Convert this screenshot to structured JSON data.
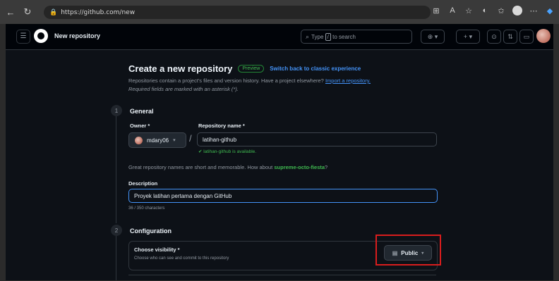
{
  "browser": {
    "url": "https://github.com/new",
    "icons": [
      "back-icon",
      "refresh-icon",
      "lock-icon",
      "grid-icon",
      "read-aloud-icon",
      "star-icon",
      "split-icon",
      "favorites-icon",
      "profile-icon",
      "more-icon",
      "copilot-icon"
    ]
  },
  "header": {
    "title": "New repository",
    "search_placeholder": "Type / to search",
    "search_prefix": "Type",
    "search_key": "/",
    "search_suffix": "to search"
  },
  "page": {
    "heading": "Create a new repository",
    "preview_badge": "Preview",
    "switch_link": "Switch back to classic experience",
    "subtitle": "Repositories contain a project's files and version history. Have a project elsewhere?",
    "import_link": "Import a repository.",
    "required_note": "Required fields are marked with an asterisk (*)."
  },
  "general": {
    "step": "1",
    "title": "General",
    "owner_label": "Owner *",
    "owner_value": "mdary06",
    "repo_label": "Repository name *",
    "repo_value": "latihan-github",
    "availability": "latihan-github is available.",
    "hint_prefix": "Great repository names are short and memorable. How about",
    "hint_suggestion": "supreme-octo-fiesta",
    "hint_suffix": "?",
    "description_label": "Description",
    "description_value": "Proyek latihan pertama dengan GitHub",
    "char_count": "36 / 350 characters"
  },
  "configuration": {
    "step": "2",
    "title": "Configuration",
    "visibility_label": "Choose visibility *",
    "visibility_desc": "Choose who can see and commit to this repository",
    "visibility_value": "Public"
  },
  "colors": {
    "accent_link": "#4493f8",
    "success": "#3fb950",
    "highlight": "#d91d1d",
    "background": "#0d1117"
  }
}
